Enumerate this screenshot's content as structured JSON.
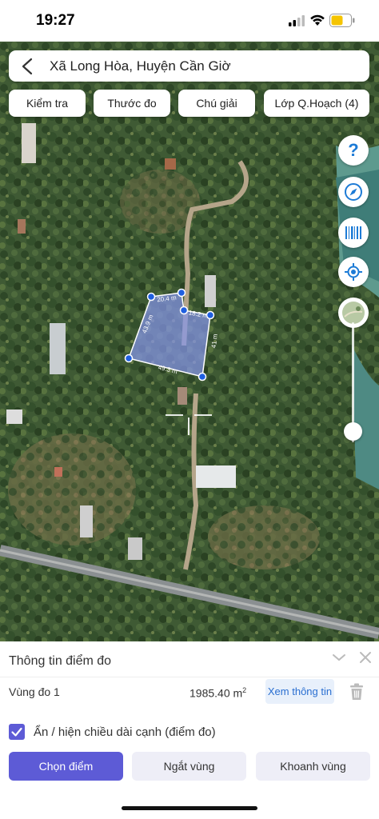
{
  "status_bar": {
    "time": "19:27"
  },
  "search": {
    "title": "Xã Long Hòa, Huyện Cần Giờ"
  },
  "chips": [
    {
      "label": "Kiểm tra"
    },
    {
      "label": "Thước đo"
    },
    {
      "label": "Chú giải"
    },
    {
      "label": "Lớp Q.Hoạch (4)"
    }
  ],
  "fabs": {
    "help": "?",
    "icons": [
      "help-icon",
      "compass-icon",
      "barcode-icon",
      "locate-icon",
      "map-layer-icon"
    ]
  },
  "measure": {
    "edges": [
      "20.4 m",
      "18.2 m",
      "41 m",
      "49.3 m",
      "43.9 m"
    ]
  },
  "panel": {
    "title": "Thông tin điểm đo",
    "zone_name": "Vùng đo 1",
    "zone_area": "1985.40 m",
    "zone_area_unit_sup": "2",
    "view_info": "Xem thông tin",
    "toggle_label": "Ẩn / hiện chiều dài cạnh (điểm đo)",
    "toggle_checked": true,
    "buttons": {
      "choose": "Chọn điểm",
      "break": "Ngắt vùng",
      "enclose": "Khoanh vùng"
    }
  },
  "colors": {
    "accent": "#5d5bd6",
    "link": "#2a6fd1",
    "polygon": "#7b8ee6",
    "vertex": "#1f5fe0"
  }
}
